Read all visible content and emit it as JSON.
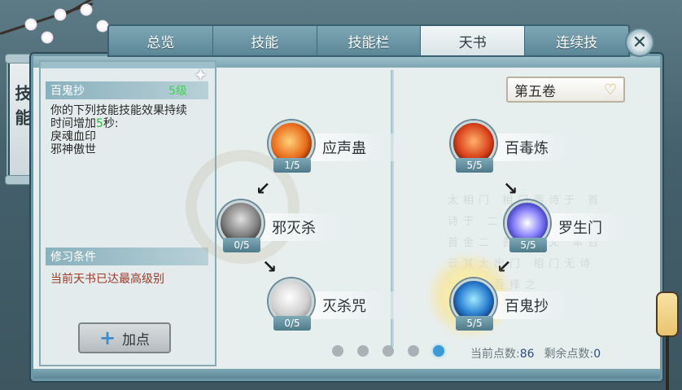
{
  "tabs": [
    {
      "label": "总览"
    },
    {
      "label": "技能"
    },
    {
      "label": "技能栏"
    },
    {
      "label": "天书",
      "active": true
    },
    {
      "label": "连续技"
    }
  ],
  "side_tab": {
    "label": "技能"
  },
  "info": {
    "skill_name": "百鬼抄",
    "level": "5级",
    "desc_line1": "你的下列技能技能效果持续",
    "desc_line2_pre": "时间增加",
    "desc_line2_num": "5",
    "desc_line2_post": "秒:",
    "desc_item1": "戾魂血印",
    "desc_item2": "邪神傲世",
    "req_header": "修习条件",
    "req_text": "当前天书已达最高级别",
    "add_button": "加点"
  },
  "volume": {
    "label": "第五卷"
  },
  "skills_left": [
    {
      "name": "应声蛊",
      "count": "1/5"
    },
    {
      "name": "邪灭杀",
      "count": "0/5"
    },
    {
      "name": "灭杀咒",
      "count": "0/5"
    }
  ],
  "skills_right": [
    {
      "name": "百毒炼",
      "count": "5/5"
    },
    {
      "name": "罗生门",
      "count": "5/5"
    },
    {
      "name": "百鬼抄",
      "count": "5/5"
    }
  ],
  "calligraphy": "太相门 相门西诗于 首诗于 二哈项吾择 以其首金二 吾择后文 本台云其太出门 相门无诗出哈项吾择之",
  "pagination": {
    "pages": 5,
    "active": 5
  },
  "points": {
    "current_label": "当前点数:",
    "current_value": "86",
    "remaining_label": "剩余点数:",
    "remaining_value": "0"
  },
  "colors": {
    "accent": "#3c9bd6",
    "panel_border": "#6f98a6",
    "level_green": "#39d64b"
  }
}
